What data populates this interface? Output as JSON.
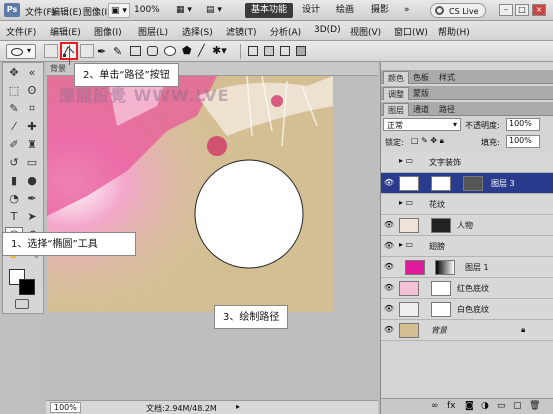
{
  "app": {
    "logo": "Ps"
  },
  "menu": [
    "文件(F)",
    "编辑(E)",
    "图像(I)",
    "图层(L)",
    "选择(S)",
    "滤镜(T)",
    "分析(A)",
    "3D(D)",
    "视图(V)",
    "窗口(W)",
    "帮助(H)"
  ],
  "titlebar": {
    "zoom": "100%",
    "workspaces": [
      "基本功能",
      "设计",
      "绘画",
      "摄影"
    ],
    "cs_live": "CS Live"
  },
  "document": {
    "tab_label": "背景",
    "watermark": "應龍設覺 WWW.LVE",
    "zoom": "100%",
    "doc_info": "文档:2.94M/48.2M"
  },
  "callouts": {
    "step2": "2、单击“路径”按钮",
    "step1": "1、选择“椭圆”工具",
    "step3": "3、绘制路径"
  },
  "panels": {
    "top_tabs": [
      "颜色",
      "色板",
      "样式"
    ],
    "mid_tabs": [
      "调整",
      "蒙版"
    ],
    "layer_tabs": [
      "图层",
      "通道",
      "路径"
    ],
    "blend_mode": "正常",
    "opacity_label": "不透明度:",
    "opacity_value": "100%",
    "lock_label": "锁定:",
    "fill_label": "填充:",
    "fill_value": "100%"
  },
  "layers": [
    {
      "name": "文字装饰",
      "type": "group"
    },
    {
      "name": "图层 3",
      "type": "layer",
      "selected": true
    },
    {
      "name": "花纹",
      "type": "group"
    },
    {
      "name": "人物",
      "type": "layer"
    },
    {
      "name": "翅膀",
      "type": "group"
    },
    {
      "name": "图层 1",
      "type": "layer"
    },
    {
      "name": "红色底纹",
      "type": "layer"
    },
    {
      "name": "白色底纹",
      "type": "layer"
    },
    {
      "name": "背景",
      "type": "layer",
      "locked": true
    }
  ],
  "colors": {
    "accent_selection": "#2a3b8e",
    "highlight_box": "#e02020",
    "pink": "#e8589a"
  }
}
